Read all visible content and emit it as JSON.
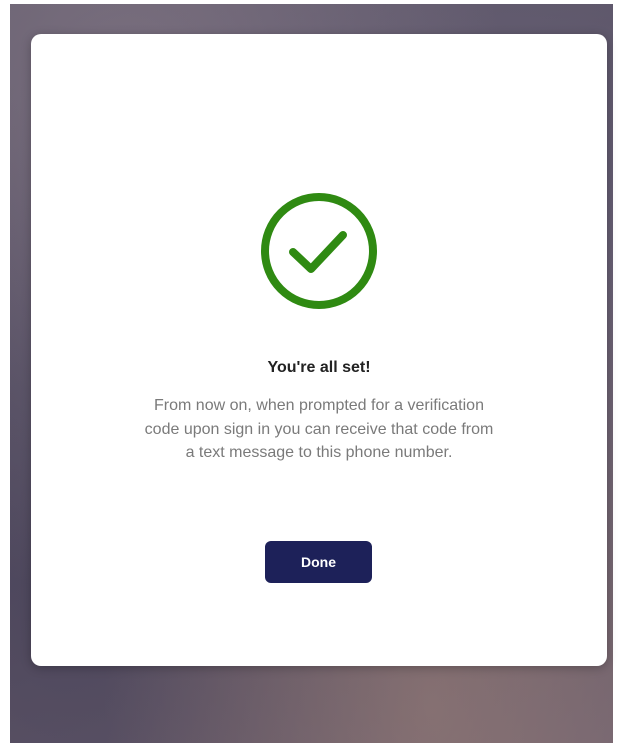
{
  "dialog": {
    "title": "You're all set!",
    "message": "From now on, when prompted for a verification code upon sign in you can receive that code from a text message to this phone number.",
    "done_label": "Done"
  },
  "icons": {
    "success": "check-circle-icon"
  },
  "colors": {
    "success_green": "#2f8a12",
    "button_navy": "#1d2159",
    "title_text": "#222222",
    "body_text": "#7a7a7a"
  }
}
